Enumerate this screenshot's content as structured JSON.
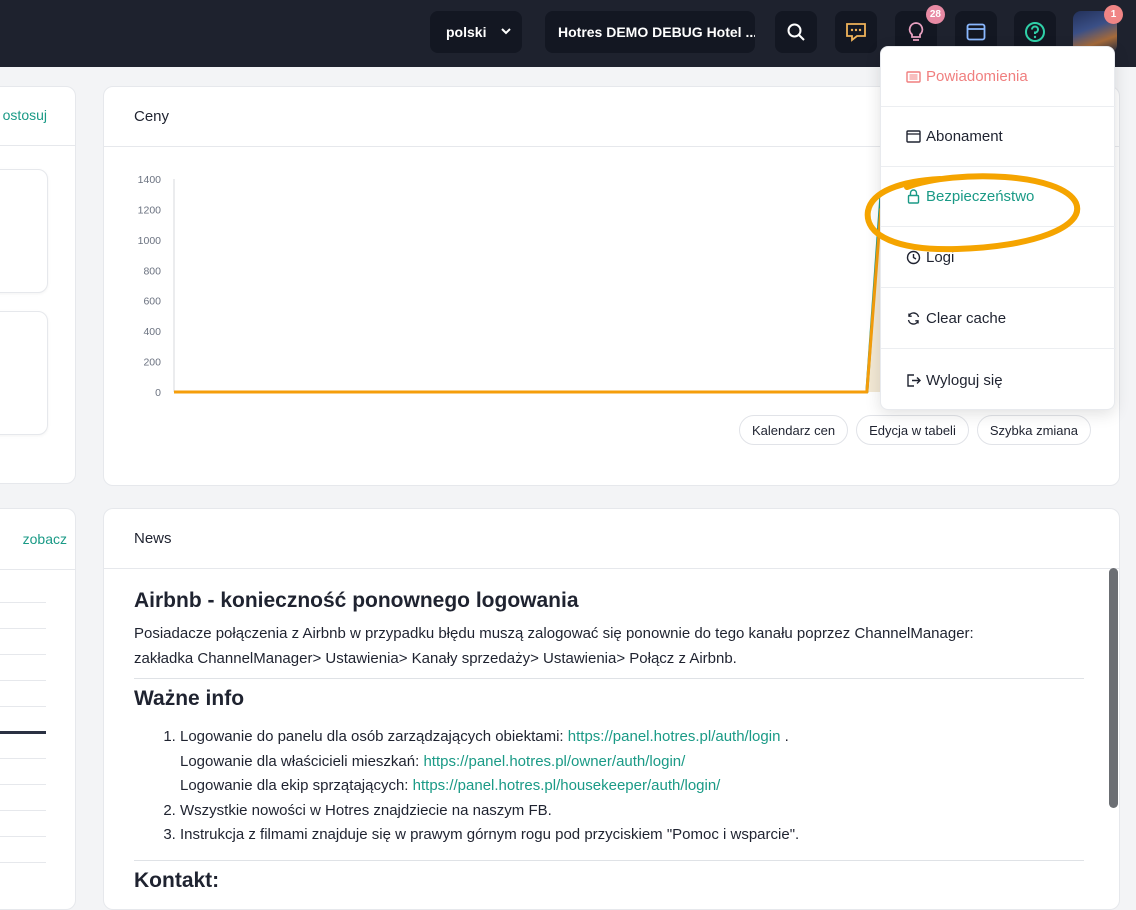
{
  "header": {
    "language": "polski",
    "hotel_name": "Hotres DEMO DEBUG Hotel ...",
    "icons": [
      "search-icon",
      "chat-icon",
      "lightbulb-icon",
      "window-icon",
      "help-icon"
    ],
    "tips_badge": "28",
    "avatar_badge": "1"
  },
  "left_panel": {
    "top_link": "ostosuj",
    "bottom_link": "zobacz"
  },
  "prices_card": {
    "title": "Ceny",
    "y_ticks": [
      "1400",
      "1200",
      "1000",
      "800",
      "600",
      "400",
      "200",
      "0"
    ],
    "buttons": [
      "Kalendarz cen",
      "Edycja w tabeli",
      "Szybka zmiana"
    ]
  },
  "chart_data": {
    "type": "area",
    "ylim": [
      0,
      1400
    ],
    "series": [
      {
        "name": "",
        "color": "#1a9a86",
        "x": [
          0,
          0.745,
          0.76,
          0.775,
          0.785,
          0.79,
          0.8,
          0.81,
          1.0
        ],
        "values": [
          0,
          0,
          1280,
          250,
          210,
          220,
          210,
          210,
          210
        ]
      },
      {
        "name": "",
        "color": "#f59e0b",
        "x": [
          0,
          0.745,
          0.76,
          0.775,
          0.785,
          0.79,
          0.8,
          0.81,
          1.0
        ],
        "values": [
          0,
          0,
          1200,
          200,
          180,
          190,
          180,
          180,
          180
        ]
      }
    ]
  },
  "news_card": {
    "title": "News",
    "article_title": "Airbnb - konieczność ponownego logowania",
    "article_text_1": "Posiadacze połączenia z Airbnb w przypadku błędu muszą zalogować się ponownie do tego kanału poprzez ChannelManager:",
    "article_text_2": "zakładka ChannelManager> Ustawienia> Kanały sprzedaży> Ustawienia> Połącz z Airbnb.",
    "info_title": "Ważne info",
    "item1_text": "Logowanie do panelu dla osób zarządzających obiektami: ",
    "item1_link": "https://panel.hotres.pl/auth/login",
    "item1_after": " .",
    "item1b_text": "Logowanie dla właścicieli mieszkań: ",
    "item1b_link": "https://panel.hotres.pl/owner/auth/login/",
    "item1c_text": "Logowanie dla ekip sprzątających: ",
    "item1c_link": "https://panel.hotres.pl/housekeeper/auth/login/",
    "item2_text": "Wszystkie nowości w Hotres znajdziecie na naszym FB.",
    "item3_text": "Instrukcja z filmami znajduje się w prawym górnym rogu pod przyciskiem \"Pomoc i wsparcie\".",
    "contact_title": "Kontakt:"
  },
  "dropdown": {
    "items": [
      {
        "label": "Powiadomienia",
        "icon": "notifications-icon",
        "color": "#f07f7f"
      },
      {
        "label": "Abonament",
        "icon": "subscription-icon",
        "color": "#1f2330"
      },
      {
        "label": "Bezpieczeństwo",
        "icon": "lock-icon",
        "color": "#1a9a86"
      },
      {
        "label": "Logi",
        "icon": "clock-icon",
        "color": "#1f2330"
      },
      {
        "label": "Clear cache",
        "icon": "refresh-icon",
        "color": "#1f2330"
      },
      {
        "label": "Wyloguj się",
        "icon": "logout-icon",
        "color": "#1f2330"
      }
    ],
    "highlight_color": "#f5a400"
  }
}
